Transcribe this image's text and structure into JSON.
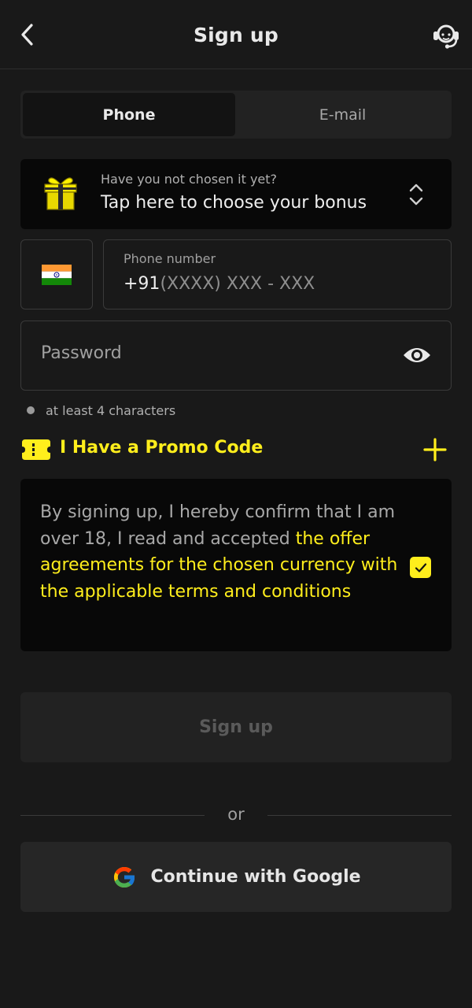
{
  "header": {
    "title": "Sign up",
    "back_icon": "chevron-left-icon",
    "support_icon": "headset-icon"
  },
  "tabs": [
    {
      "label": "Phone",
      "active": true
    },
    {
      "label": "E-mail",
      "active": false
    }
  ],
  "bonus": {
    "subtitle": "Have you not chosen it yet?",
    "title": "Tap here to choose your bonus",
    "icon": "gift-icon"
  },
  "phone": {
    "country_flag": "india-flag-icon",
    "label": "Phone number",
    "prefix": "+91",
    "placeholder": "(XXXX) XXX - XXX"
  },
  "password": {
    "placeholder": "Password",
    "hint": "at least 4 characters"
  },
  "promo": {
    "label": "I Have a Promo Code"
  },
  "agreement": {
    "text": "By signing up, I hereby confirm that I am over 18, I read and accepted ",
    "link": "the offer agreements for the chosen currency with the applicable terms and conditions",
    "checked": true
  },
  "signup_button": "Sign up",
  "divider_text": "or",
  "google_button": "Continue with Google",
  "colors": {
    "accent": "#ffee1c",
    "background": "#191919",
    "card": "#080808"
  }
}
